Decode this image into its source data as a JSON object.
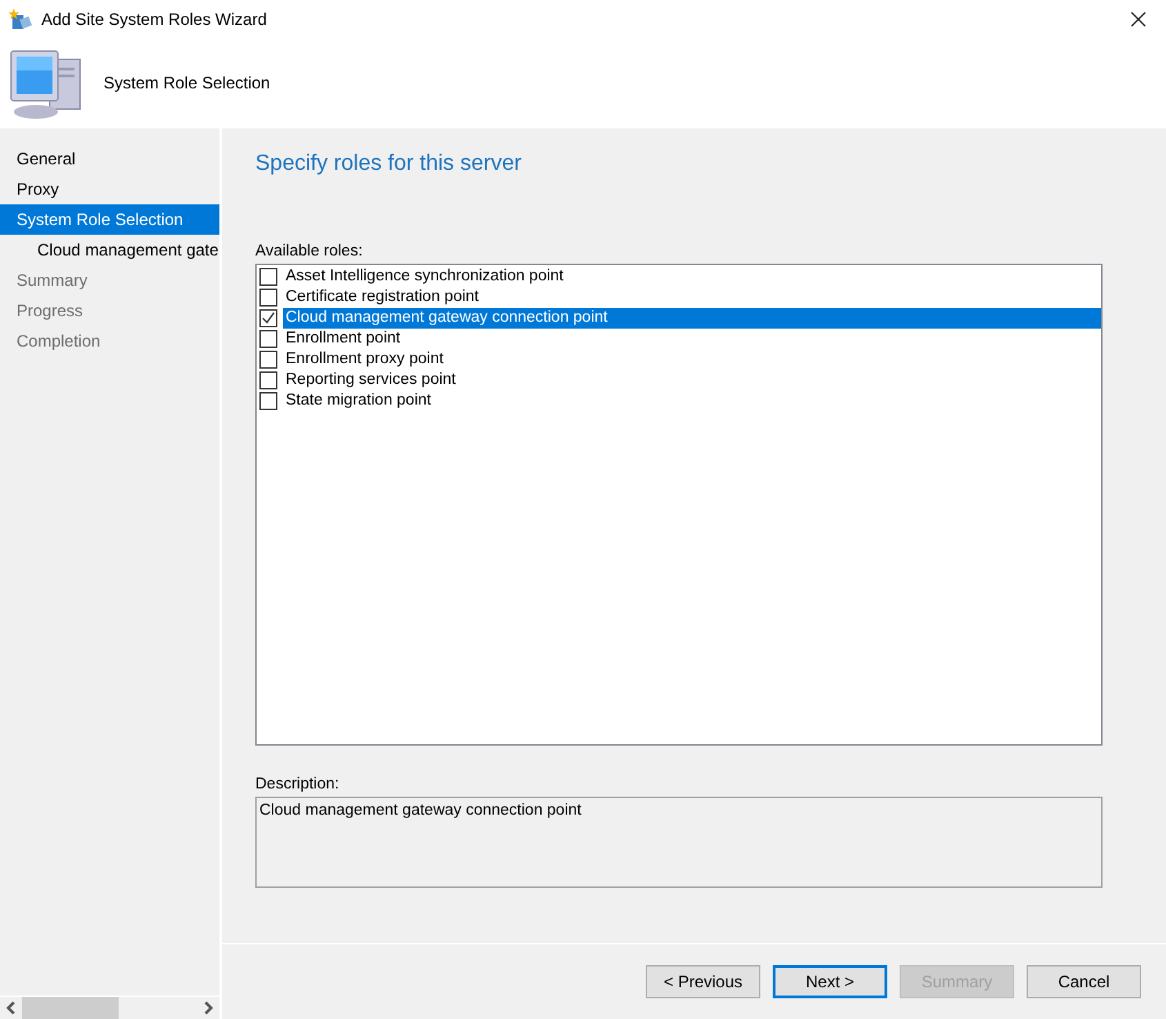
{
  "window": {
    "title": "Add Site System Roles Wizard"
  },
  "header": {
    "title": "System Role Selection"
  },
  "sidebar": {
    "items": [
      {
        "label": "General",
        "selected": false,
        "disabled": false
      },
      {
        "label": "Proxy",
        "selected": false,
        "disabled": false
      },
      {
        "label": "System Role Selection",
        "selected": true,
        "disabled": false,
        "children": [
          {
            "label": "Cloud management gate",
            "selected": false,
            "disabled": false
          }
        ]
      },
      {
        "label": "Summary",
        "selected": false,
        "disabled": true
      },
      {
        "label": "Progress",
        "selected": false,
        "disabled": true
      },
      {
        "label": "Completion",
        "selected": false,
        "disabled": true
      }
    ]
  },
  "content": {
    "heading": "Specify roles for this server",
    "roles_label": "Available roles:",
    "roles": [
      {
        "label": "Asset Intelligence synchronization point",
        "checked": false,
        "selected": false
      },
      {
        "label": "Certificate registration point",
        "checked": false,
        "selected": false
      },
      {
        "label": "Cloud management gateway connection point",
        "checked": true,
        "selected": true
      },
      {
        "label": "Enrollment point",
        "checked": false,
        "selected": false
      },
      {
        "label": "Enrollment proxy point",
        "checked": false,
        "selected": false
      },
      {
        "label": "Reporting services point",
        "checked": false,
        "selected": false
      },
      {
        "label": "State migration point",
        "checked": false,
        "selected": false
      }
    ],
    "description_label": "Description:",
    "description": "Cloud management gateway connection point"
  },
  "buttons": [
    {
      "label": "< Previous",
      "disabled": false,
      "default": false
    },
    {
      "label": "Next >",
      "disabled": false,
      "default": true
    },
    {
      "label": "Summary",
      "disabled": true,
      "default": false
    },
    {
      "label": "Cancel",
      "disabled": false,
      "default": false
    }
  ]
}
